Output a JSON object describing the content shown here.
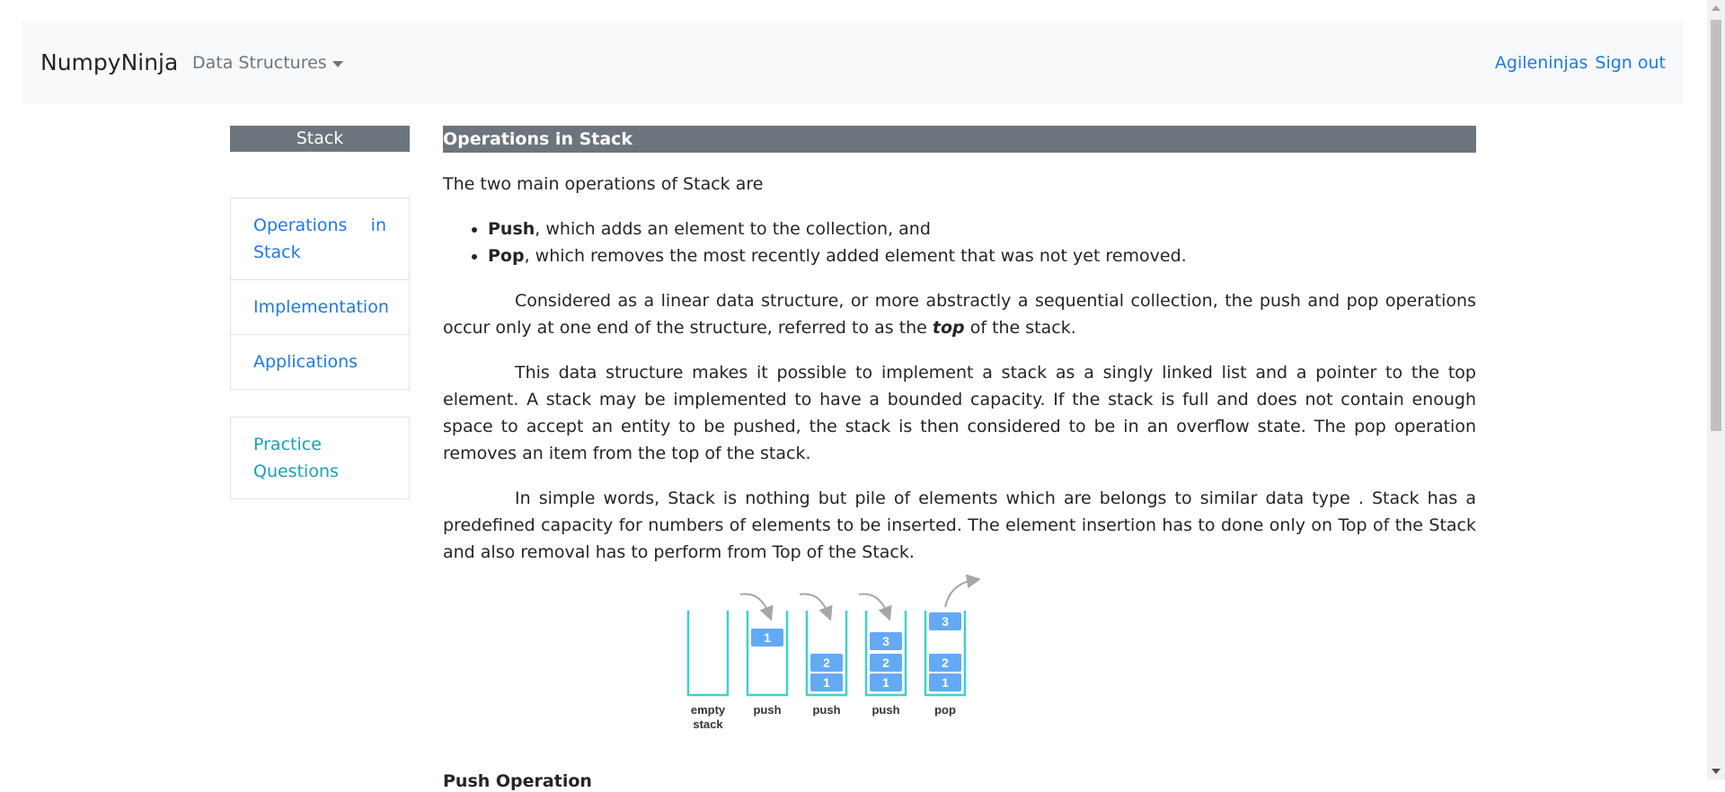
{
  "navbar": {
    "brand": "NumpyNinja",
    "dropdown_label": "Data Structures",
    "username": "Agileninjas",
    "signout": "Sign out"
  },
  "sidebar": {
    "title": "Stack",
    "items": [
      {
        "label_line1_a": "Operations",
        "label_line1_b": "in",
        "label_line2": "Stack"
      },
      {
        "label": "Implementation"
      },
      {
        "label": "Applications"
      }
    ],
    "practice": {
      "line1": "Practice",
      "line2": "Questions"
    }
  },
  "content": {
    "title": "Operations in Stack",
    "intro": "The two main operations of Stack are",
    "bullets": [
      {
        "term": "Push",
        "desc": ", which adds an element to the collection, and"
      },
      {
        "term": "Pop",
        "desc": ", which removes the most recently added element that was not yet removed."
      }
    ],
    "para1_before": "Considered as a linear data structure, or more abstractly a sequential collection, the push and pop operations occur only at one end of the structure, referred to as the ",
    "para1_emph": "top",
    "para1_after": " of the stack.",
    "para2": "This data structure makes it possible to implement a stack as a singly linked list and a pointer to the top element. A stack may be implemented to have a bounded capacity. If the stack is full and does not contain enough space to accept an entity to be pushed, the stack is then considered to be in an overflow state. The pop operation removes an item from the top of the stack.",
    "para3": "In simple words, Stack is nothing but pile of elements which are belongs to similar data type . Stack has a predefined capacity for numbers of elements to be inserted. The element insertion has to done only on Top of the Stack and also removal has to perform  from Top of the Stack.",
    "next_heading": "Push Operation"
  },
  "diagram": {
    "labels": [
      "empty",
      "stack",
      "push",
      "push",
      "push",
      "pop"
    ],
    "stack1": [
      "1"
    ],
    "stack2": [
      "2",
      "1"
    ],
    "stack3": [
      "3",
      "2",
      "1"
    ],
    "stack4_popped": "3",
    "stack4": [
      "2",
      "1"
    ],
    "colors": {
      "container": "#3fd1cc",
      "box": "#64a9f4",
      "arrow": "#a6a6a6"
    }
  }
}
